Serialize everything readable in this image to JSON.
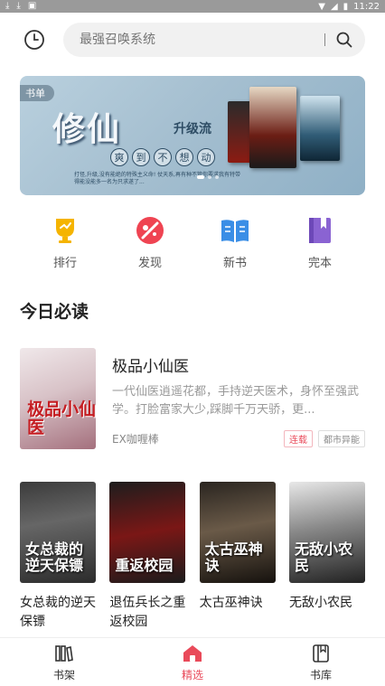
{
  "status_bar": {
    "time": "11:22"
  },
  "search": {
    "placeholder": "最强召唤系统"
  },
  "banner": {
    "tag": "书单",
    "title": "修仙",
    "subtitle": "升级流",
    "slogan_chars": [
      "爽",
      "到",
      "不",
      "想",
      "动"
    ],
    "description": "打怪,升级,没有能绝的特殊主义命! 仗天系,再有种不管你要求我有特带得能没能多一名为只求遂了..."
  },
  "categories": [
    {
      "label": "排行",
      "icon": "trophy-icon"
    },
    {
      "label": "发现",
      "icon": "discover-icon"
    },
    {
      "label": "新书",
      "icon": "open-book-icon"
    },
    {
      "label": "完本",
      "icon": "bookmark-book-icon"
    }
  ],
  "section": {
    "title": "今日必读"
  },
  "featured": {
    "title": "极品小仙医",
    "description": "一代仙医逍遥花都，手持逆天医术，身怀至强武学。打脸富家大少,踩脚千万天骄，更...",
    "author": "EX咖喱棒",
    "status_tag": "连载",
    "genre_tag": "都市异能",
    "cover_text": "极品小仙医"
  },
  "books": [
    {
      "title": "女总裁的逆天保镖",
      "cover_text": "女总裁的逆天保镖"
    },
    {
      "title": "退伍兵长之重返校园",
      "cover_text": "重返校园"
    },
    {
      "title": "太古巫神诀",
      "cover_text": "太古巫神诀"
    },
    {
      "title": "无敌小农民",
      "cover_text": "无敌小农民"
    }
  ],
  "tabs": [
    {
      "label": "书架",
      "icon": "bookshelf-icon",
      "active": false
    },
    {
      "label": "精选",
      "icon": "home-icon",
      "active": true
    },
    {
      "label": "书库",
      "icon": "library-icon",
      "active": false
    }
  ],
  "colors": {
    "accent": "#e94a5a",
    "trophy": "#f5b400",
    "discover": "#ef4452",
    "newbook": "#3a8ee6",
    "finished": "#8a63d2"
  }
}
